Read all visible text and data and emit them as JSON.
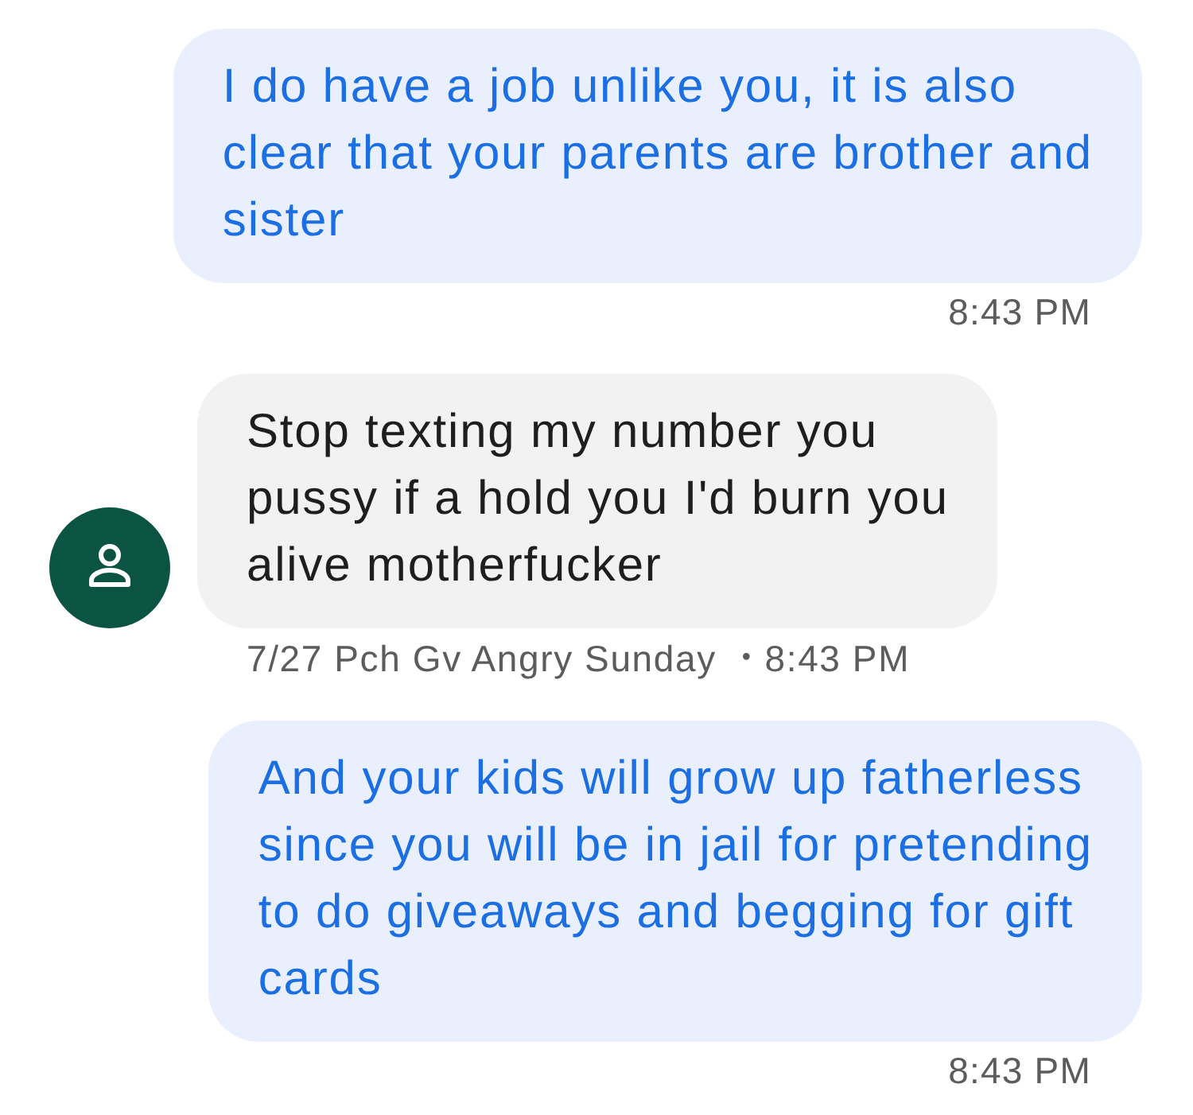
{
  "messages": [
    {
      "kind": "outgoing",
      "text": "I do have a job unlike you, it is also\nclear that your parents are brother and\nsister",
      "time": "8:43 PM"
    },
    {
      "kind": "incoming",
      "text": "Stop texting my number you\npussy if a hold you I'd burn you\nalive motherfucker",
      "sender": "7/27 Pch Gv Angry Sunday",
      "separator": "•",
      "time": "8:43 PM"
    },
    {
      "kind": "outgoing",
      "text": "And your kids will grow up fatherless\nsince you will be in jail for pretending\nto do giveaways and begging for gift\ncards",
      "time": "8:43 PM"
    }
  ]
}
